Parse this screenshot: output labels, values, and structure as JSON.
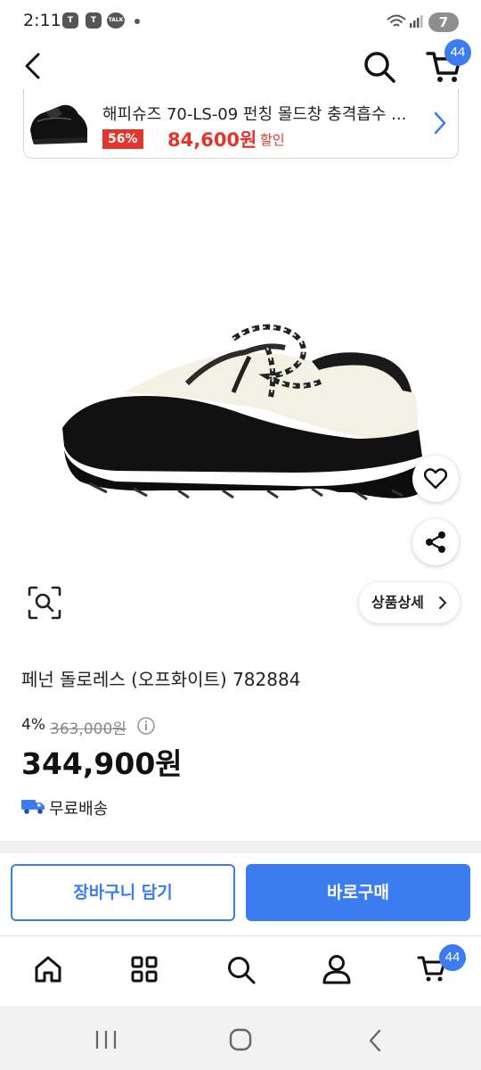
{
  "status_bar": {
    "time": "2:11",
    "battery": "7",
    "notif_talk": "TALK"
  },
  "header": {
    "cart_count": "44"
  },
  "banner": {
    "product_name": "해피슈즈 70-LS-09 펀칭 몰드창 충격흡수 ...",
    "discount_badge": "56%",
    "price": "84,600원",
    "sale_label": "할인"
  },
  "actions": {
    "detail_label": "상품상세"
  },
  "product": {
    "title": "페넌 돌로레스 (오프화이트) 782884",
    "discount_rate": "4%",
    "original_price": "363,000원",
    "price": "344,900원",
    "shipping": "무료배송"
  },
  "buttons": {
    "add_to_cart": "장바구니 담기",
    "buy_now": "바로구매"
  },
  "bottom_nav": {
    "cart_count": "44"
  },
  "colors": {
    "accent": "#3b7cf0",
    "sale_red": "#e3352b"
  }
}
